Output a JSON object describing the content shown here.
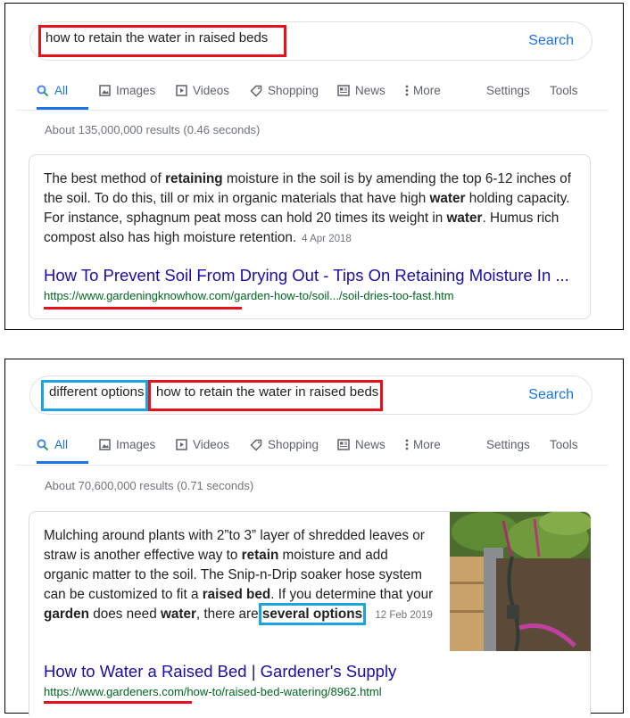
{
  "nav": {
    "search_label": "Search",
    "tabs": [
      {
        "label": "All"
      },
      {
        "label": "Images"
      },
      {
        "label": "Videos"
      },
      {
        "label": "Shopping"
      },
      {
        "label": "News"
      },
      {
        "label": "More"
      }
    ],
    "settings_label": "Settings",
    "tools_label": "Tools"
  },
  "panel1": {
    "query": "how to retain the water in raised beds",
    "stats": "About 135,000,000 results (0.46 seconds)",
    "snippet_parts": [
      "The best method of ",
      "retaining",
      " moisture in the soil is by amending the top 6-12 inches of the soil. To do this, till or mix in organic materials that have high ",
      "water",
      " holding capacity. For instance, sphagnum peat moss can hold 20 times its weight in ",
      "water",
      ". Humus rich compost also has high moisture retention."
    ],
    "date": "4 Apr 2018",
    "title": "How To Prevent Soil From Drying Out - Tips On Retaining Moisture In ...",
    "url": "https://www.gardeningknowhow.com/garden-how-to/soil.../soil-dries-too-fast.htm"
  },
  "panel2": {
    "query_prefix": "different options",
    "query": "how to retain the water in raised beds",
    "stats": "About 70,600,000 results (0.71 seconds)",
    "snippet_parts": [
      "Mulching around plants with 2”to 3” layer of shredded leaves or straw is another effective way to ",
      "retain",
      " moisture and add organic matter to the soil. The Snip-n-Drip soaker hose system can be customized to fit a ",
      "raised bed",
      ". If you determine that your ",
      "garden",
      " does need ",
      "water",
      ", there are ",
      "several options",
      "."
    ],
    "date": "12 Feb 2019",
    "title": "How to Water a Raised Bed | Gardener's Supply",
    "url": "https://www.gardeners.com/how-to/raised-bed-watering/8962.html"
  },
  "colors": {
    "accent": "#1a73e8",
    "link": "#1a0dab",
    "url": "#006621",
    "highlight_red": "#e8101b",
    "highlight_blue": "#1ba5e0"
  }
}
